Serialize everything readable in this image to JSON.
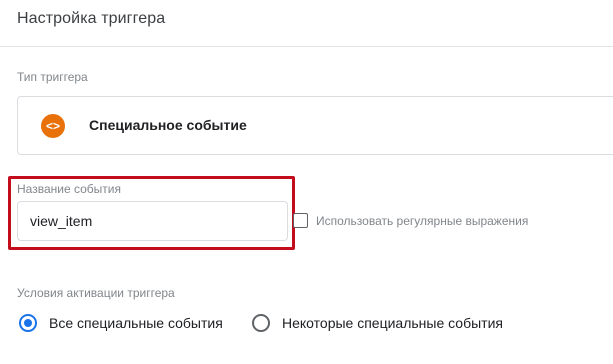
{
  "header": {
    "title": "Настройка триггера"
  },
  "trigger_type": {
    "label": "Тип триггера",
    "value": "Специальное событие",
    "icon": "code-brackets-icon",
    "icon_glyph": "<>",
    "icon_color": "#e8710a"
  },
  "event_name": {
    "label": "Название события",
    "value": "view_item",
    "highlight_color": "#c40d1c"
  },
  "regex_option": {
    "label": "Использовать регулярные выражения",
    "checked": false
  },
  "activation": {
    "label": "Условия активации триггера",
    "options": [
      {
        "label": "Все специальные события",
        "selected": true
      },
      {
        "label": "Некоторые специальные события",
        "selected": false
      }
    ],
    "accent_color": "#1a73e8"
  }
}
